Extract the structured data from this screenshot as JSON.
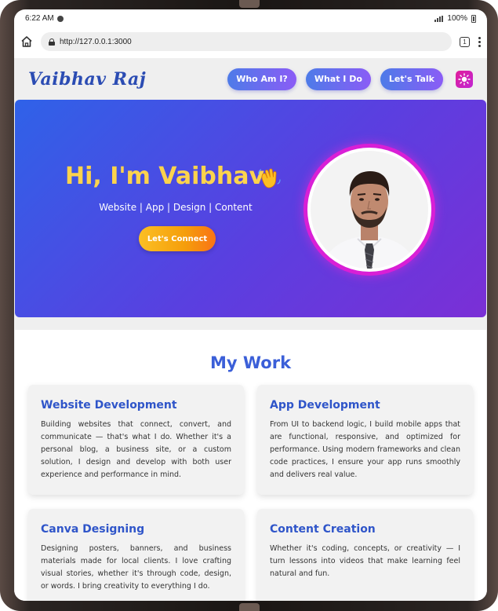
{
  "status_bar": {
    "time": "6:22 AM",
    "battery": "100%"
  },
  "browser": {
    "url": "http://127.0.0.1:3000",
    "tab_count": "1"
  },
  "nav": {
    "brand": "Vaibhav Raj",
    "links": [
      "Who Am I?",
      "What I Do",
      "Let's Talk"
    ]
  },
  "hero": {
    "greeting": "Hi, I'm Vaibhav",
    "subtitle": "Website | App | Design | Content",
    "cta_label": "Let's Connect"
  },
  "work": {
    "title": "My Work",
    "cards": [
      {
        "title": "Website Development",
        "text": "Building websites that connect, convert, and communicate — that's what I do. Whether it's a personal blog, a business site, or a custom solution, I design and develop with both user experience and performance in mind."
      },
      {
        "title": "App Development",
        "text": "From UI to backend logic, I build mobile apps that are functional, responsive, and optimized for performance. Using modern frameworks and clean code practices, I ensure your app runs smoothly and delivers real value."
      },
      {
        "title": "Canva Designing",
        "text": "Designing posters, banners, and business materials made for local clients. I love crafting visual stories, whether it's through code, design, or words. I bring creativity to everything I do."
      },
      {
        "title": "Content Creation",
        "text": "Whether it's coding, concepts, or creativity — I turn lessons into videos that make learning feel natural and fun."
      }
    ]
  },
  "colors": {
    "accent_blue": "#3b5fd8",
    "hero_gradient_start": "#2f62e8",
    "hero_gradient_end": "#7b2fd6",
    "greeting_yellow": "#fcd34d",
    "avatar_ring": "#d91fd6"
  },
  "icons": [
    "home-icon",
    "lock-icon",
    "tabs-icon",
    "menu-icon",
    "sun-icon",
    "wave-hand-icon"
  ]
}
